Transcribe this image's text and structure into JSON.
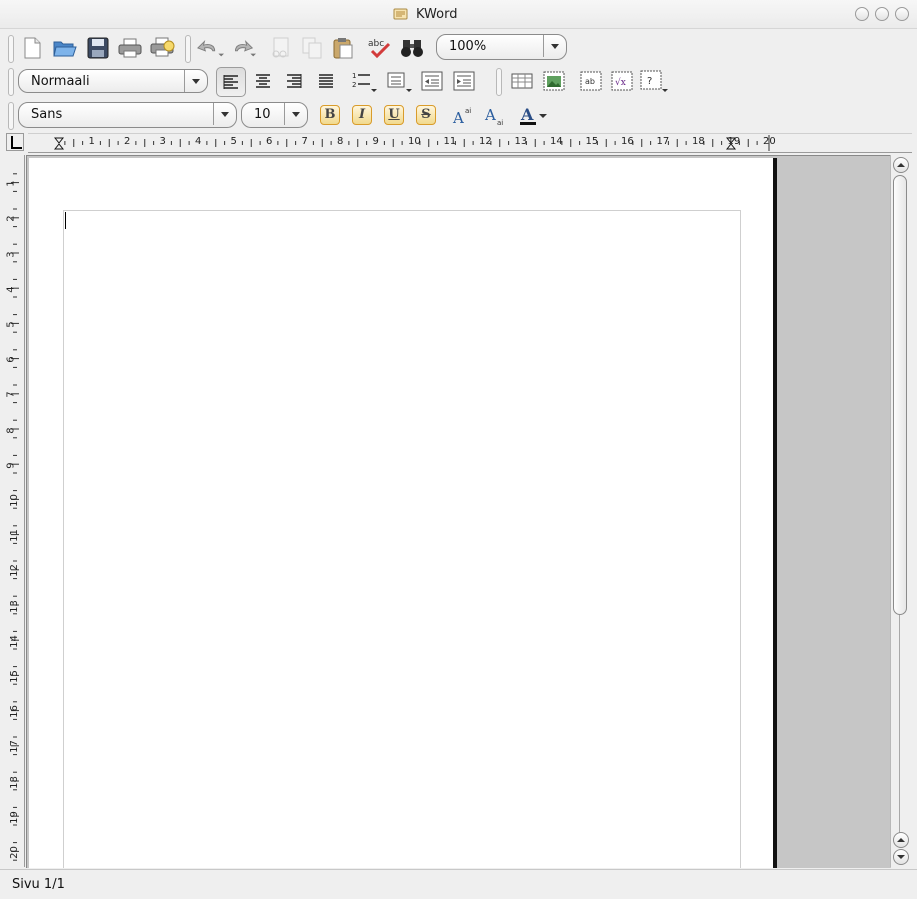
{
  "window": {
    "title": "KWord"
  },
  "toolbar1": {
    "buttons": [
      "new-document",
      "open-document",
      "save-document",
      "print",
      "print-preview",
      "undo",
      "redo",
      "cut",
      "copy",
      "paste",
      "spellcheck",
      "find"
    ],
    "zoom": "100%"
  },
  "toolbar2": {
    "style": "Normaali",
    "buttons": [
      "align-left",
      "align-center",
      "align-right",
      "align-justify",
      "numbered-list",
      "bullet-list",
      "decrease-indent",
      "increase-indent",
      "insert-table",
      "insert-picture",
      "insert-text-frame",
      "insert-formula",
      "insert-part"
    ]
  },
  "toolbar3": {
    "font": "Sans",
    "size": "10",
    "format_buttons": [
      "B",
      "I",
      "U",
      "S"
    ],
    "extra_buttons": [
      "superscript",
      "subscript",
      "text-color"
    ]
  },
  "ruler": {
    "h_labels": [
      "1",
      "2",
      "3",
      "4",
      "5",
      "6",
      "7",
      "8",
      "9",
      "10",
      "11",
      "12",
      "13",
      "14",
      "15",
      "16",
      "17",
      "18",
      "19",
      "20"
    ],
    "v_labels": [
      "1",
      "2",
      "3",
      "4",
      "5",
      "6",
      "7",
      "8",
      "9",
      "10",
      "11",
      "12",
      "13",
      "14",
      "15",
      "16",
      "17",
      "18",
      "19",
      "20"
    ]
  },
  "status": {
    "page": "Sivu 1/1"
  },
  "colors": {
    "page_bg": "#ffffff",
    "canvas_bg": "#c6c6c6",
    "accent_format": "#d99c2b"
  }
}
